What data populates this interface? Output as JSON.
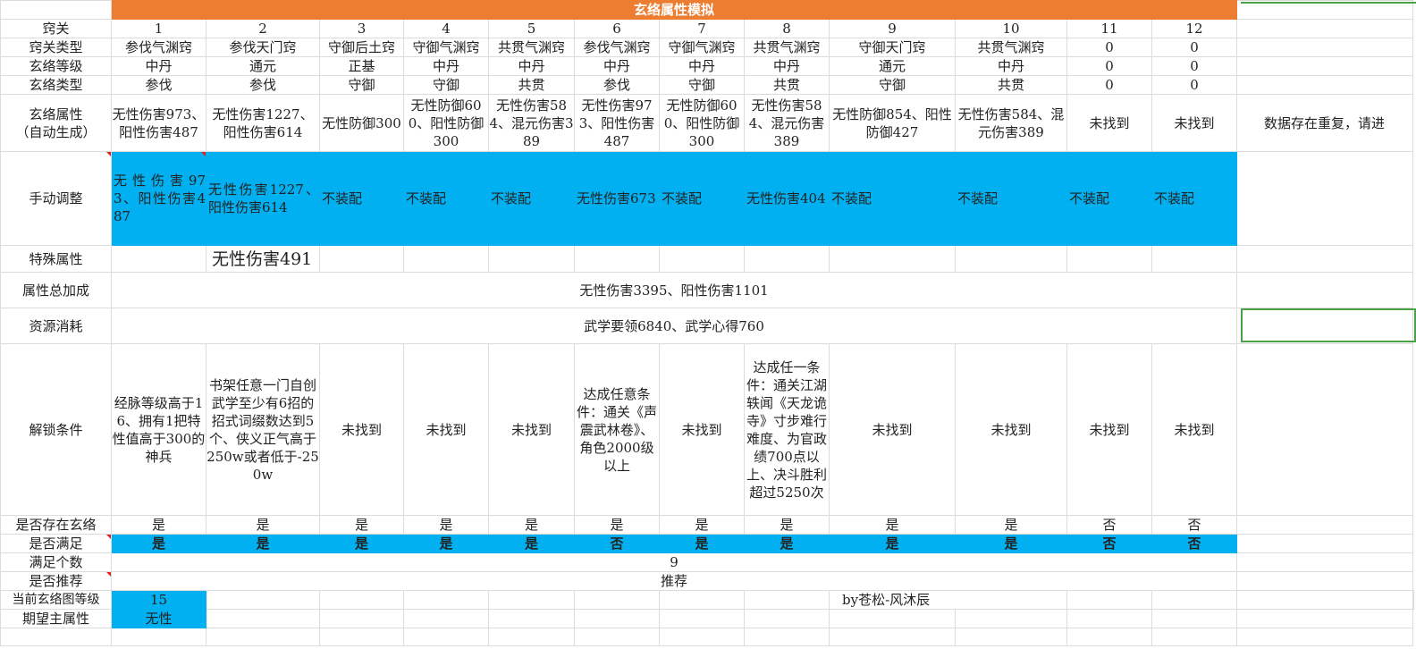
{
  "title": "玄络属性模拟",
  "labels": {
    "qiaoguan": "窍关",
    "type": "窍关类型",
    "grade": "玄络等级",
    "xtype": "玄络类型",
    "attr": "玄络属性\n（自动生成）",
    "manual": "手动调整",
    "special": "特殊属性",
    "total": "属性总加成",
    "cost": "资源消耗",
    "unlock": "解锁条件",
    "exists": "是否存在玄络",
    "satisfy": "是否满足",
    "count": "满足个数",
    "recommend": "是否推荐",
    "curlevel": "当前玄络图等级",
    "expect": "期望主属性"
  },
  "columns": [
    {
      "num": "1",
      "type": "参伐气渊窍",
      "grade": "中丹",
      "xtype": "参伐",
      "attr": "无性伤害973、阳性伤害487",
      "manual": "无性伤害973、阳性伤害487",
      "special": "",
      "unlock": "经脉等级高于16、拥有1把特性值高于300的神兵",
      "exists": "是",
      "satisfy": "是"
    },
    {
      "num": "2",
      "type": "参伐天门窍",
      "grade": "通元",
      "xtype": "参伐",
      "attr": "无性伤害1227、阳性伤害614",
      "manual": "无性伤害1227、阳性伤害614",
      "special": "无性伤害491",
      "unlock": "书架任意一门自创武学至少有6招的招式词缀数达到5个、侠义正气高于250w或者低于-250w",
      "exists": "是",
      "satisfy": "是"
    },
    {
      "num": "3",
      "type": "守御后土窍",
      "grade": "正基",
      "xtype": "守御",
      "attr": "无性防御300",
      "manual": "不装配",
      "special": "",
      "unlock": "未找到",
      "exists": "是",
      "satisfy": "是"
    },
    {
      "num": "4",
      "type": "守御气渊窍",
      "grade": "中丹",
      "xtype": "守御",
      "attr": "无性防御600、阳性防御300",
      "manual": "不装配",
      "special": "",
      "unlock": "未找到",
      "exists": "是",
      "satisfy": "是"
    },
    {
      "num": "5",
      "type": "共贯气渊窍",
      "grade": "中丹",
      "xtype": "共贯",
      "attr": "无性伤害584、混元伤害389",
      "manual": "不装配",
      "special": "",
      "unlock": "未找到",
      "exists": "是",
      "satisfy": "是"
    },
    {
      "num": "6",
      "type": "参伐气渊窍",
      "grade": "中丹",
      "xtype": "参伐",
      "attr": "无性伤害973、阳性伤害487",
      "manual": "无性伤害673",
      "special": "",
      "unlock": "达成任意条件：通关《声震武林卷》、角色2000级以上",
      "exists": "是",
      "satisfy": "否"
    },
    {
      "num": "7",
      "type": "守御气渊窍",
      "grade": "中丹",
      "xtype": "守御",
      "attr": "无性防御600、阳性防御300",
      "manual": "不装配",
      "special": "",
      "unlock": "未找到",
      "exists": "是",
      "satisfy": "是"
    },
    {
      "num": "8",
      "type": "共贯气渊窍",
      "grade": "中丹",
      "xtype": "共贯",
      "attr": "无性伤害584、混元伤害389",
      "manual": "无性伤害404",
      "special": "",
      "unlock": "达成任一条件：通关江湖轶闻《天龙诡寺》寸步难行难度、为官政绩700点以上、决斗胜利超过5250次",
      "exists": "是",
      "satisfy": "是"
    },
    {
      "num": "9",
      "type": "守御天门窍",
      "grade": "通元",
      "xtype": "守御",
      "attr": "无性防御854、阳性防御427",
      "manual": "不装配",
      "special": "",
      "unlock": "未找到",
      "exists": "是",
      "satisfy": "是"
    },
    {
      "num": "10",
      "type": "共贯气渊窍",
      "grade": "中丹",
      "xtype": "共贯",
      "attr": "无性伤害584、混元伤害389",
      "manual": "不装配",
      "special": "",
      "unlock": "未找到",
      "exists": "是",
      "satisfy": "是"
    },
    {
      "num": "11",
      "type": "0",
      "grade": "0",
      "xtype": "0",
      "attr": "未找到",
      "manual": "不装配",
      "special": "",
      "unlock": "未找到",
      "exists": "否",
      "satisfy": "否"
    },
    {
      "num": "12",
      "type": "0",
      "grade": "0",
      "xtype": "0",
      "attr": "未找到",
      "manual": "不装配",
      "special": "",
      "unlock": "未找到",
      "exists": "否",
      "satisfy": "否"
    }
  ],
  "side_note": "数据存在重复，请进",
  "total_value": "无性伤害3395、阳性伤害1101",
  "cost_value": "武学要领6840、武学心得760",
  "count_value": "9",
  "recommend_value": "推荐",
  "curlevel_value": "15",
  "expect_value": "无性",
  "author": "by苍松-风沐辰",
  "colors": {
    "header_orange": "#ed7d31",
    "highlight_blue": "#00b0f0",
    "selection_green": "#4aa146"
  }
}
